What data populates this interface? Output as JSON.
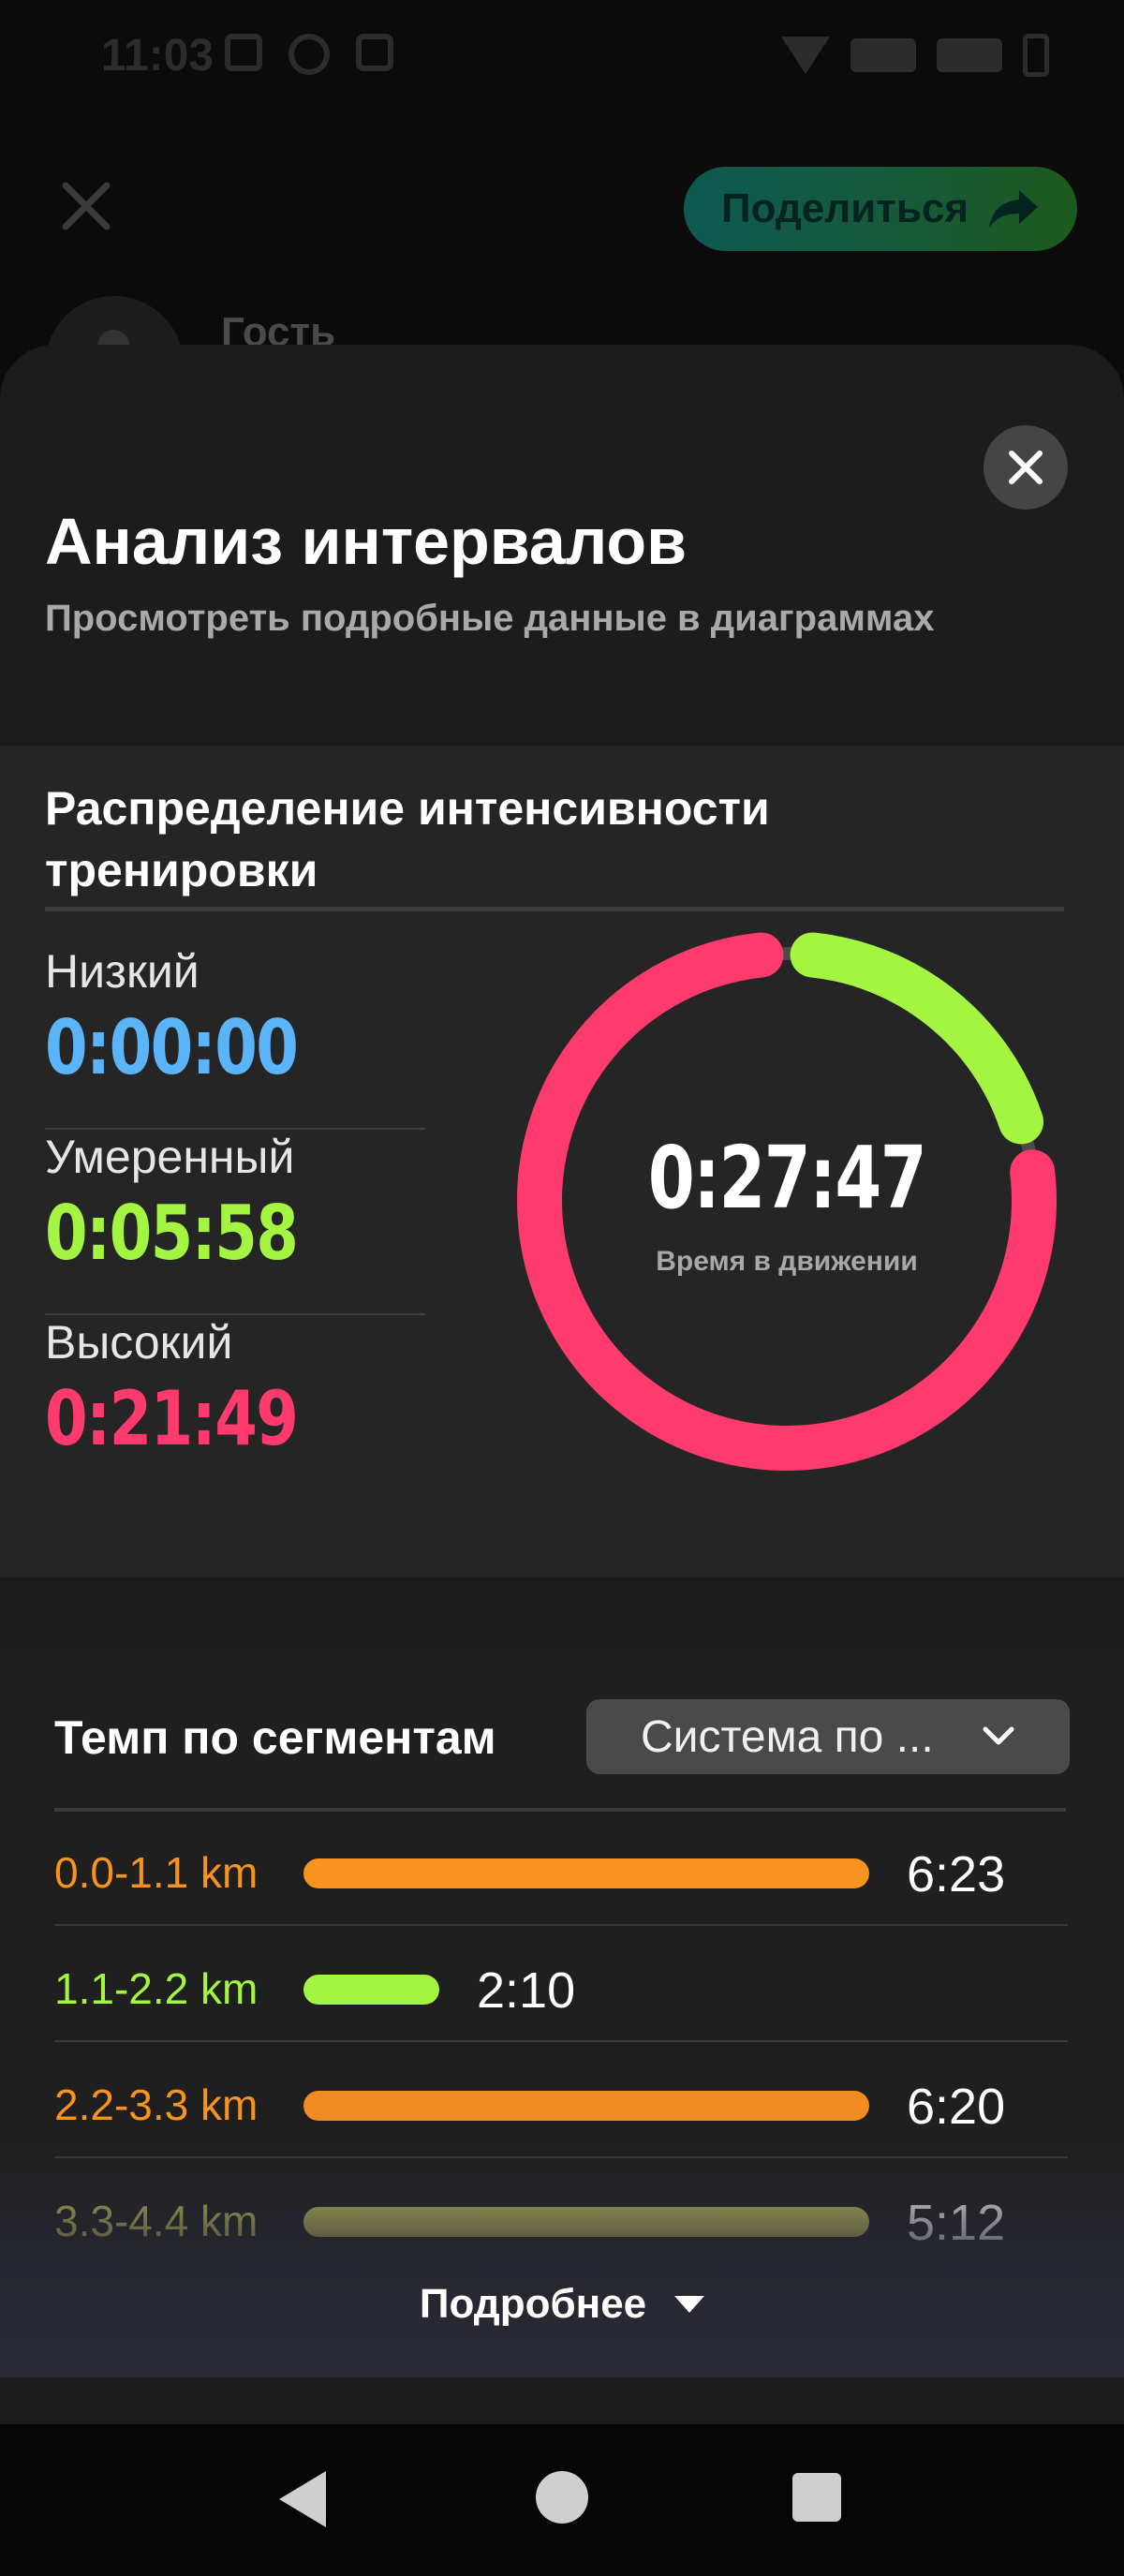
{
  "status_bar": {
    "time": "11:03"
  },
  "header": {
    "share_label": "Поделиться",
    "guest_name": "Гость"
  },
  "sheet": {
    "title": "Анализ интервалов",
    "subtitle": "Просмотреть подробные данные в диаграммах"
  },
  "intensity": {
    "title": "Распределение интенсивности тренировки",
    "zones": [
      {
        "label": "Низкий",
        "value": "0:00:00",
        "color": "#5ab4f7"
      },
      {
        "label": "Умеренный",
        "value": "0:05:58",
        "color": "#a4f542"
      },
      {
        "label": "Высокий",
        "value": "0:21:49",
        "color": "#ff3b6d"
      }
    ],
    "total_value": "0:27:47",
    "total_label": "Время в движении",
    "ring": {
      "low_seconds": 0,
      "moderate_seconds": 358,
      "high_seconds": 1309,
      "track_color": "#4a4a4a"
    }
  },
  "pace": {
    "title": "Темп по сегментам",
    "dropdown_value": "Система по ...",
    "segments": [
      {
        "label": "0.0-1.1 km",
        "value": "6:23",
        "fraction": 1.0,
        "label_color": "#f7931e",
        "bar_color": "#f7931e"
      },
      {
        "label": "1.1-2.2 km",
        "value": "2:10",
        "fraction": 0.24,
        "label_color": "#a4f542",
        "bar_color": "#a4f542"
      },
      {
        "label": "2.2-3.3 km",
        "value": "6:20",
        "fraction": 1.0,
        "label_color": "#f7931e",
        "bar_color": "#f08a23"
      },
      {
        "label": "3.3-4.4 km",
        "value": "5:12",
        "fraction": 1.0,
        "label_color": "#c9c860",
        "bar_color": "#c9c860"
      }
    ],
    "more_label": "Подробнее"
  }
}
